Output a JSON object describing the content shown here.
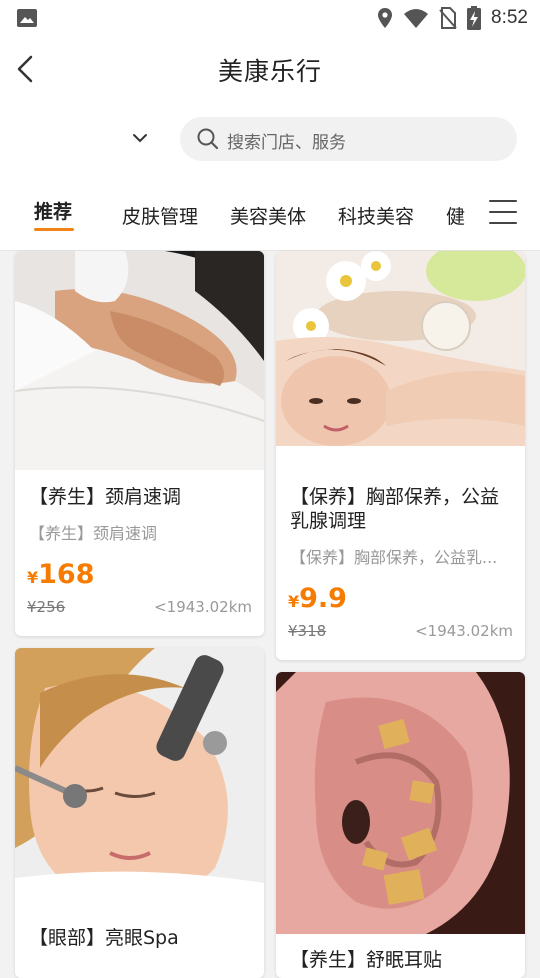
{
  "status": {
    "time": "8:52"
  },
  "header": {
    "title": "美康乐行"
  },
  "city": {
    "label": ""
  },
  "search": {
    "placeholder": "搜索门店、服务"
  },
  "tabs": [
    {
      "label": "推荐",
      "active": true
    },
    {
      "label": "皮肤管理"
    },
    {
      "label": "美容美体"
    },
    {
      "label": "科技美容"
    },
    {
      "label": "健"
    }
  ],
  "products": [
    {
      "title": "【养生】颈肩速调",
      "subtitle": "【养生】颈肩速调",
      "currency": "¥",
      "price": "168",
      "original_price": "¥256",
      "distance": "<1943.02km"
    },
    {
      "title": "【保养】胸部保养，公益乳腺调理",
      "subtitle": "【保养】胸部保养，公益乳...",
      "currency": "¥",
      "price": "9.9",
      "original_price": "¥318",
      "distance": "<1943.02km"
    },
    {
      "title": "【眼部】亮眼Spa"
    },
    {
      "title": "【养生】舒眠耳贴"
    }
  ],
  "colors": {
    "accent": "#f57c00",
    "tab_underline": "#f08418"
  }
}
